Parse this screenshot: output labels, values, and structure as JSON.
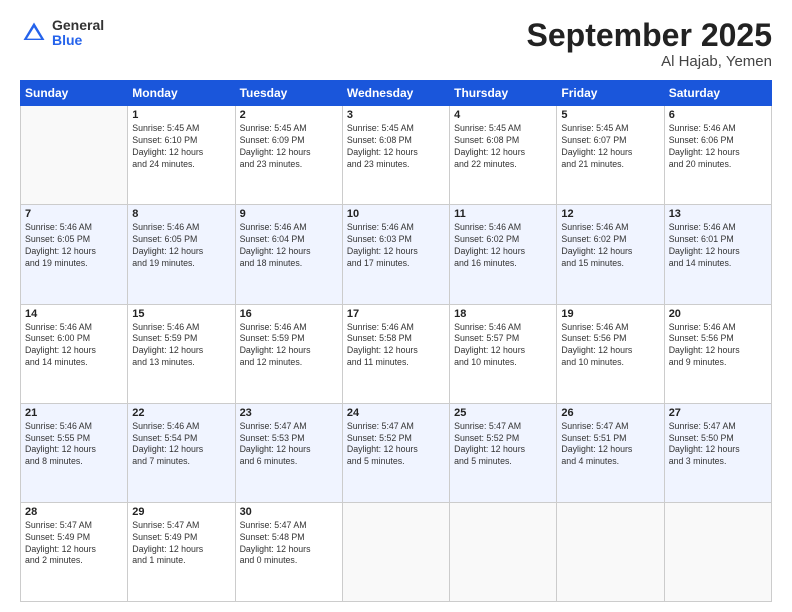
{
  "header": {
    "logo_general": "General",
    "logo_blue": "Blue",
    "title": "September 2025",
    "subtitle": "Al Hajab, Yemen"
  },
  "calendar": {
    "days_of_week": [
      "Sunday",
      "Monday",
      "Tuesday",
      "Wednesday",
      "Thursday",
      "Friday",
      "Saturday"
    ],
    "weeks": [
      [
        {
          "day": "",
          "info": ""
        },
        {
          "day": "1",
          "info": "Sunrise: 5:45 AM\nSunset: 6:10 PM\nDaylight: 12 hours\nand 24 minutes."
        },
        {
          "day": "2",
          "info": "Sunrise: 5:45 AM\nSunset: 6:09 PM\nDaylight: 12 hours\nand 23 minutes."
        },
        {
          "day": "3",
          "info": "Sunrise: 5:45 AM\nSunset: 6:08 PM\nDaylight: 12 hours\nand 23 minutes."
        },
        {
          "day": "4",
          "info": "Sunrise: 5:45 AM\nSunset: 6:08 PM\nDaylight: 12 hours\nand 22 minutes."
        },
        {
          "day": "5",
          "info": "Sunrise: 5:45 AM\nSunset: 6:07 PM\nDaylight: 12 hours\nand 21 minutes."
        },
        {
          "day": "6",
          "info": "Sunrise: 5:46 AM\nSunset: 6:06 PM\nDaylight: 12 hours\nand 20 minutes."
        }
      ],
      [
        {
          "day": "7",
          "info": "Sunrise: 5:46 AM\nSunset: 6:05 PM\nDaylight: 12 hours\nand 19 minutes."
        },
        {
          "day": "8",
          "info": "Sunrise: 5:46 AM\nSunset: 6:05 PM\nDaylight: 12 hours\nand 19 minutes."
        },
        {
          "day": "9",
          "info": "Sunrise: 5:46 AM\nSunset: 6:04 PM\nDaylight: 12 hours\nand 18 minutes."
        },
        {
          "day": "10",
          "info": "Sunrise: 5:46 AM\nSunset: 6:03 PM\nDaylight: 12 hours\nand 17 minutes."
        },
        {
          "day": "11",
          "info": "Sunrise: 5:46 AM\nSunset: 6:02 PM\nDaylight: 12 hours\nand 16 minutes."
        },
        {
          "day": "12",
          "info": "Sunrise: 5:46 AM\nSunset: 6:02 PM\nDaylight: 12 hours\nand 15 minutes."
        },
        {
          "day": "13",
          "info": "Sunrise: 5:46 AM\nSunset: 6:01 PM\nDaylight: 12 hours\nand 14 minutes."
        }
      ],
      [
        {
          "day": "14",
          "info": "Sunrise: 5:46 AM\nSunset: 6:00 PM\nDaylight: 12 hours\nand 14 minutes."
        },
        {
          "day": "15",
          "info": "Sunrise: 5:46 AM\nSunset: 5:59 PM\nDaylight: 12 hours\nand 13 minutes."
        },
        {
          "day": "16",
          "info": "Sunrise: 5:46 AM\nSunset: 5:59 PM\nDaylight: 12 hours\nand 12 minutes."
        },
        {
          "day": "17",
          "info": "Sunrise: 5:46 AM\nSunset: 5:58 PM\nDaylight: 12 hours\nand 11 minutes."
        },
        {
          "day": "18",
          "info": "Sunrise: 5:46 AM\nSunset: 5:57 PM\nDaylight: 12 hours\nand 10 minutes."
        },
        {
          "day": "19",
          "info": "Sunrise: 5:46 AM\nSunset: 5:56 PM\nDaylight: 12 hours\nand 10 minutes."
        },
        {
          "day": "20",
          "info": "Sunrise: 5:46 AM\nSunset: 5:56 PM\nDaylight: 12 hours\nand 9 minutes."
        }
      ],
      [
        {
          "day": "21",
          "info": "Sunrise: 5:46 AM\nSunset: 5:55 PM\nDaylight: 12 hours\nand 8 minutes."
        },
        {
          "day": "22",
          "info": "Sunrise: 5:46 AM\nSunset: 5:54 PM\nDaylight: 12 hours\nand 7 minutes."
        },
        {
          "day": "23",
          "info": "Sunrise: 5:47 AM\nSunset: 5:53 PM\nDaylight: 12 hours\nand 6 minutes."
        },
        {
          "day": "24",
          "info": "Sunrise: 5:47 AM\nSunset: 5:52 PM\nDaylight: 12 hours\nand 5 minutes."
        },
        {
          "day": "25",
          "info": "Sunrise: 5:47 AM\nSunset: 5:52 PM\nDaylight: 12 hours\nand 5 minutes."
        },
        {
          "day": "26",
          "info": "Sunrise: 5:47 AM\nSunset: 5:51 PM\nDaylight: 12 hours\nand 4 minutes."
        },
        {
          "day": "27",
          "info": "Sunrise: 5:47 AM\nSunset: 5:50 PM\nDaylight: 12 hours\nand 3 minutes."
        }
      ],
      [
        {
          "day": "28",
          "info": "Sunrise: 5:47 AM\nSunset: 5:49 PM\nDaylight: 12 hours\nand 2 minutes."
        },
        {
          "day": "29",
          "info": "Sunrise: 5:47 AM\nSunset: 5:49 PM\nDaylight: 12 hours\nand 1 minute."
        },
        {
          "day": "30",
          "info": "Sunrise: 5:47 AM\nSunset: 5:48 PM\nDaylight: 12 hours\nand 0 minutes."
        },
        {
          "day": "",
          "info": ""
        },
        {
          "day": "",
          "info": ""
        },
        {
          "day": "",
          "info": ""
        },
        {
          "day": "",
          "info": ""
        }
      ]
    ]
  }
}
